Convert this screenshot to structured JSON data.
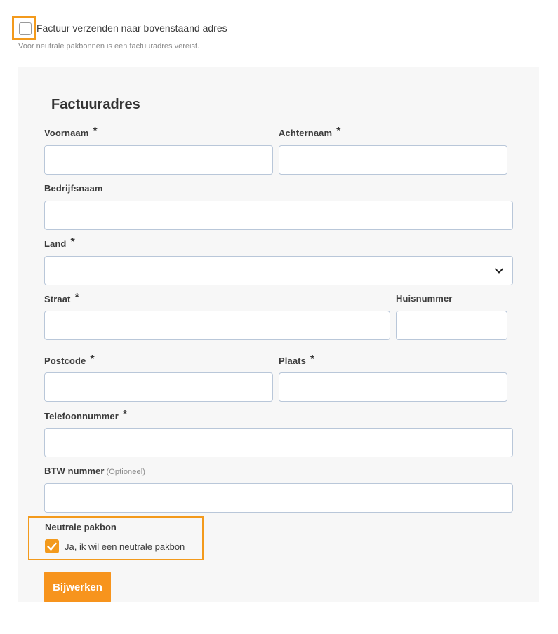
{
  "top_checkbox": {
    "label": "Factuur verzenden naar bovenstaand adres",
    "checked": false,
    "hint": "Voor neutrale pakbonnen is een factuuradres vereist."
  },
  "form": {
    "title": "Factuuradres",
    "required_marker": "*",
    "fields": {
      "voornaam": {
        "label": "Voornaam",
        "value": ""
      },
      "achternaam": {
        "label": "Achternaam",
        "value": ""
      },
      "bedrijfsnaam": {
        "label": "Bedrijfsnaam",
        "value": ""
      },
      "land": {
        "label": "Land",
        "value": ""
      },
      "straat": {
        "label": "Straat",
        "value": ""
      },
      "huisnummer": {
        "label": "Huisnummer",
        "value": ""
      },
      "postcode": {
        "label": "Postcode",
        "value": ""
      },
      "plaats": {
        "label": "Plaats",
        "value": ""
      },
      "telefoonnummer": {
        "label": "Telefoonnummer",
        "value": ""
      },
      "btw": {
        "label": "BTW nummer",
        "optional": "(Optioneel)",
        "value": ""
      }
    }
  },
  "pakbon": {
    "title": "Neutrale pakbon",
    "label": "Ja, ik wil een neutrale pakbon",
    "checked": true
  },
  "submit": {
    "label": "Bijwerken"
  },
  "colors": {
    "accent": "#f39a1c",
    "panel": "#f7f7f7",
    "input_border": "#b9c7d9"
  }
}
